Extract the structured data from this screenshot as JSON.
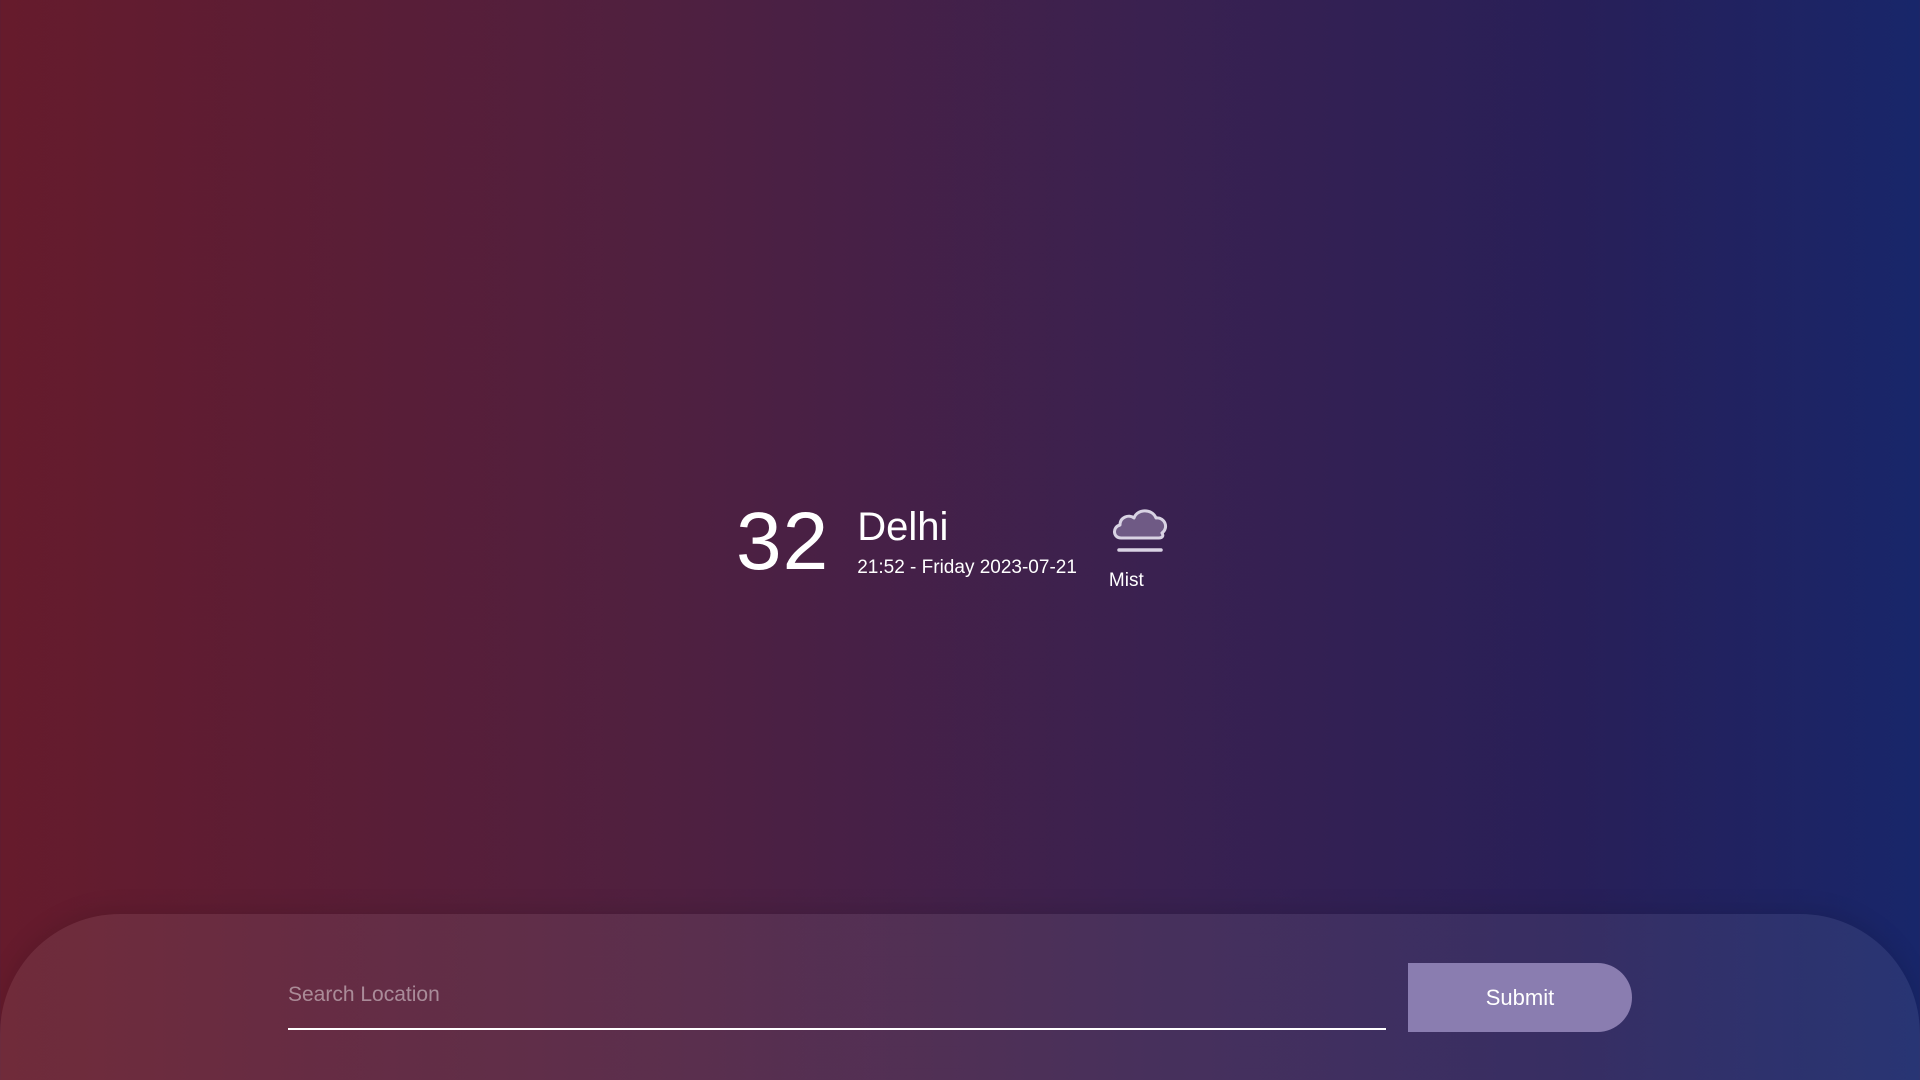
{
  "weather": {
    "temperature": "32",
    "city": "Delhi",
    "datetime": "21:52 - Friday 2023-07-21",
    "condition": "Mist",
    "condition_icon": "mist-cloud-icon"
  },
  "search": {
    "placeholder": "Search Location",
    "value": "",
    "submit_label": "Submit"
  },
  "colors": {
    "gradient_left": "#661b2c",
    "gradient_right": "#18266a",
    "button": "#8a7db0"
  }
}
